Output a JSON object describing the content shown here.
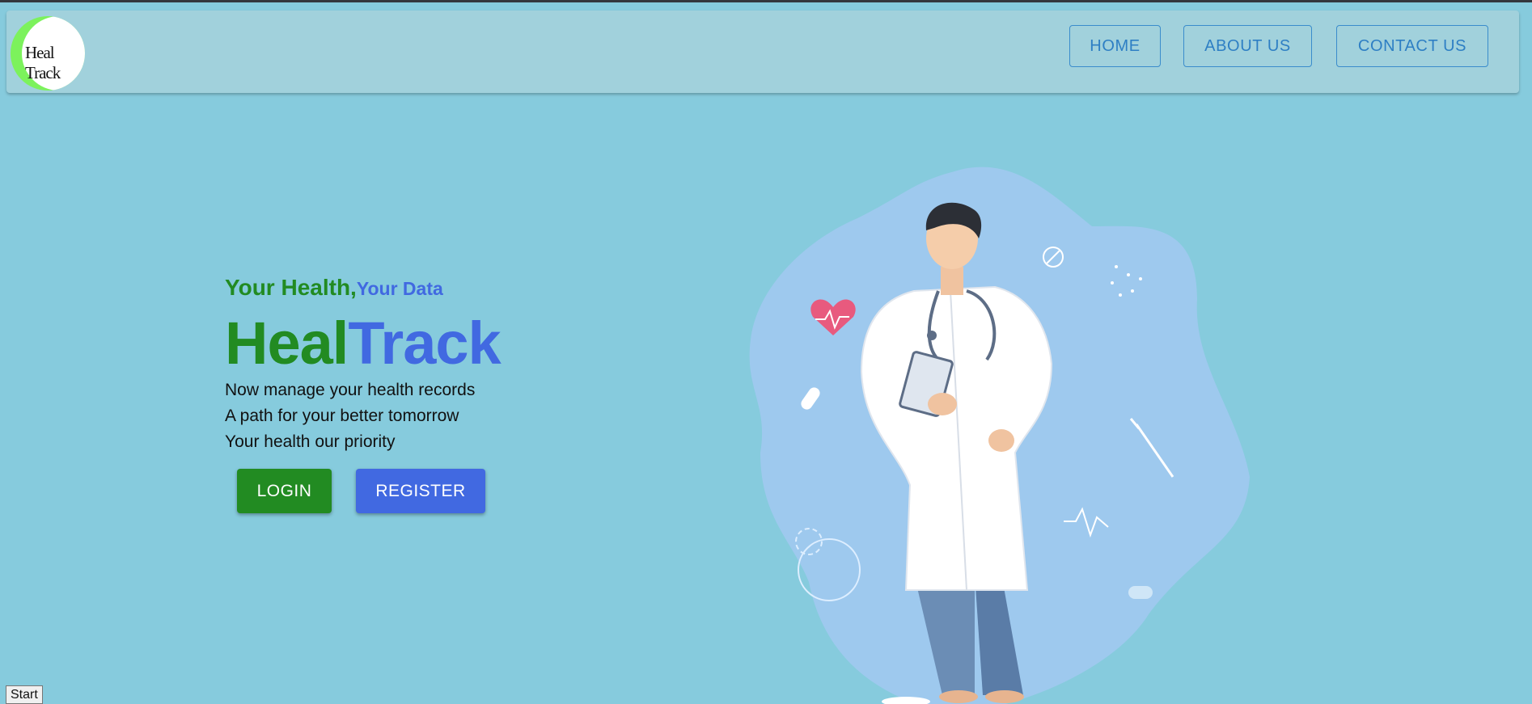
{
  "navbar": {
    "logo_text": "Heal Track",
    "links": [
      {
        "label": "HOME"
      },
      {
        "label": "ABOUT US"
      },
      {
        "label": "CONTACT US"
      }
    ]
  },
  "hero": {
    "tagline_part1": "Your Health,",
    "tagline_part2": "Your Data",
    "brand_part1": "Heal",
    "brand_part2": "Track",
    "lines": [
      "Now manage your health records",
      "A path for your better tomorrow",
      "Your health our priority"
    ],
    "login_label": "LOGIN",
    "register_label": "REGISTER"
  },
  "footer": {
    "start_label": "Start"
  },
  "colors": {
    "background": "#86cbdd",
    "navbar": "#a1d1dc",
    "green": "#228b22",
    "blue": "#4169e1",
    "nav_link": "#2e7fc4"
  }
}
